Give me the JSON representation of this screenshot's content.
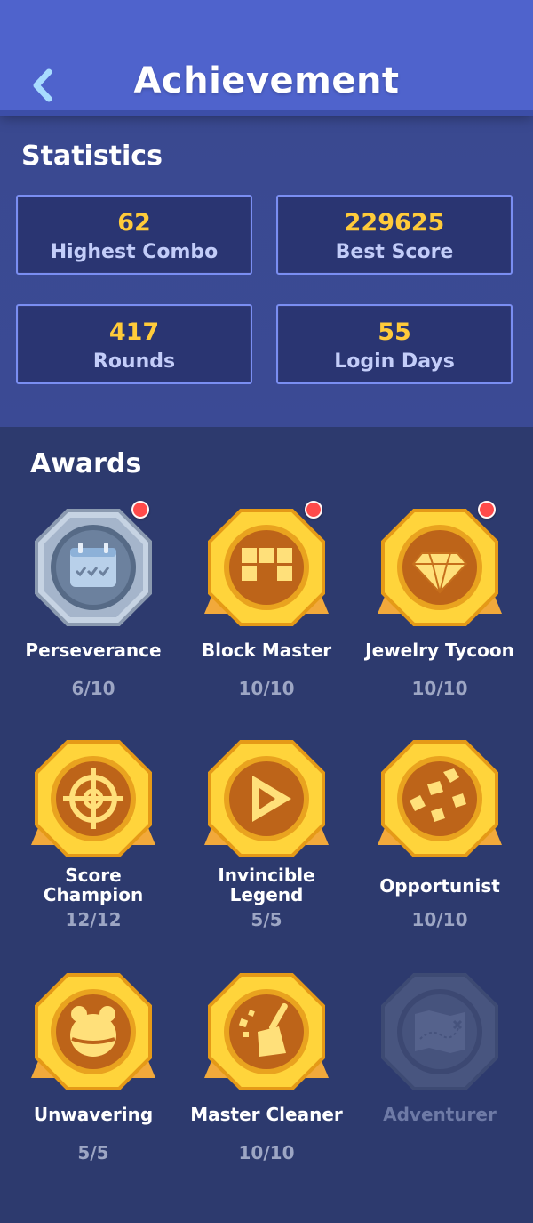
{
  "header": {
    "title": "Achievement"
  },
  "statistics": {
    "title": "Statistics",
    "items": [
      {
        "value": "62",
        "label": "Highest Combo"
      },
      {
        "value": "229625",
        "label": "Best Score"
      },
      {
        "value": "417",
        "label": "Rounds"
      },
      {
        "value": "55",
        "label": "Login Days"
      }
    ]
  },
  "awards": {
    "title": "Awards",
    "items": [
      {
        "name": "Perseverance",
        "progress": "6/10",
        "icon": "calendar-icon",
        "style": "silver",
        "new": true
      },
      {
        "name": "Block Master",
        "progress": "10/10",
        "icon": "blocks-icon",
        "style": "gold",
        "new": true
      },
      {
        "name": "Jewelry Tycoon",
        "progress": "10/10",
        "icon": "diamond-icon",
        "style": "gold",
        "new": true
      },
      {
        "name": "Score\nChampion",
        "progress": "12/12",
        "icon": "target-icon",
        "style": "gold",
        "new": false
      },
      {
        "name": "Invincible\nLegend",
        "progress": "5/5",
        "icon": "play-icon",
        "style": "gold",
        "new": false
      },
      {
        "name": "Opportunist",
        "progress": "10/10",
        "icon": "gold-nuggets-icon",
        "style": "gold",
        "new": false
      },
      {
        "name": "Unwavering",
        "progress": "5/5",
        "icon": "bear-icon",
        "style": "gold",
        "new": false
      },
      {
        "name": "Master Cleaner",
        "progress": "10/10",
        "icon": "broom-icon",
        "style": "gold",
        "new": false
      },
      {
        "name": "Adventurer",
        "progress": "",
        "icon": "map-icon",
        "style": "locked",
        "new": false
      }
    ]
  },
  "colors": {
    "header": "#4f63cc",
    "stats_bg": "#3a4990",
    "awards_bg": "#2d3a6e",
    "value_gold": "#ffcb3a",
    "badge_gold": "#f7c52b",
    "badge_brown": "#c0661a",
    "notification_red": "#ff4a4a"
  }
}
